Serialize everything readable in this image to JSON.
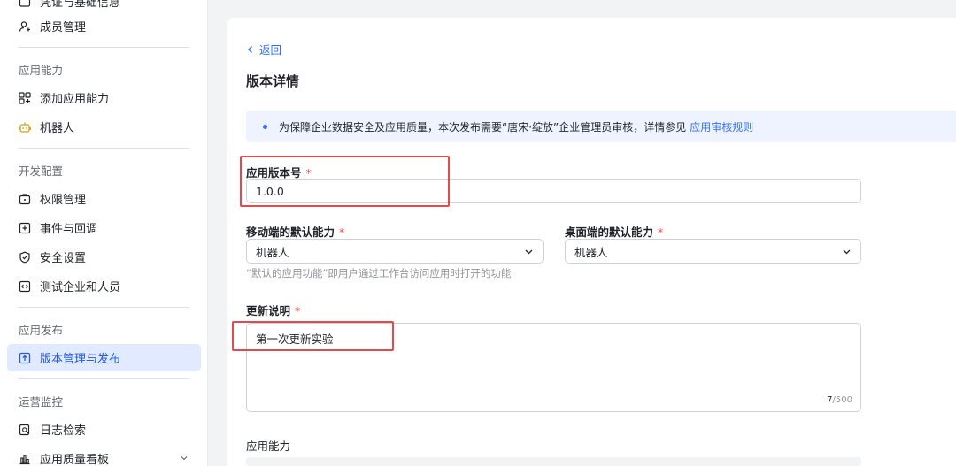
{
  "sidebar": {
    "cutoff_item": "凭证与基础信息",
    "member_mgmt": "成员管理",
    "sections": {
      "app_ability": "应用能力",
      "dev_config": "开发配置",
      "app_release": "应用发布",
      "ops_monitor": "运营监控"
    },
    "items": {
      "add_ability": "添加应用能力",
      "bot": "机器人",
      "permissions": "权限管理",
      "events": "事件与回调",
      "security": "安全设置",
      "test_org": "测试企业和人员",
      "version_mgmt": "版本管理与发布",
      "log_search": "日志检索",
      "quality_board": "应用质量看板"
    }
  },
  "main": {
    "back_label": "返回",
    "title": "版本详情",
    "notice": {
      "text": "为保障企业数据安全及应用质量，本次发布需要“唐宋·绽放”企业管理员审核，详情参见",
      "link": "应用审核规则"
    },
    "version_field": {
      "label": "应用版本号",
      "required": "*",
      "value": "1.0.0"
    },
    "mobile_default": {
      "label": "移动端的默认能力",
      "required": "*",
      "value": "机器人"
    },
    "desktop_default": {
      "label": "桌面端的默认能力",
      "required": "*",
      "value": "机器人"
    },
    "default_hint": "“默认的应用功能”即用户通过工作台访问应用时打开的功能",
    "update_notes": {
      "label": "更新说明",
      "required": "*",
      "value": "第一次更新实验",
      "count": "7",
      "max": "/500"
    },
    "ability_label": "应用能力"
  },
  "colors": {
    "accent": "#3370ff",
    "active_bg": "#e1eaff",
    "required": "#f54a45",
    "highlight_box": "#e5484d",
    "bot_icon": "#d4a017"
  },
  "icons": {
    "member": "person-add-icon",
    "add_ability": "grid-plus-icon",
    "bot": "robot-icon",
    "permissions": "lock-icon",
    "events": "plus-square-icon",
    "security": "shield-icon",
    "test_org": "code-icon",
    "version": "upload-icon",
    "log": "search-doc-icon",
    "quality": "bar-chart-icon"
  }
}
